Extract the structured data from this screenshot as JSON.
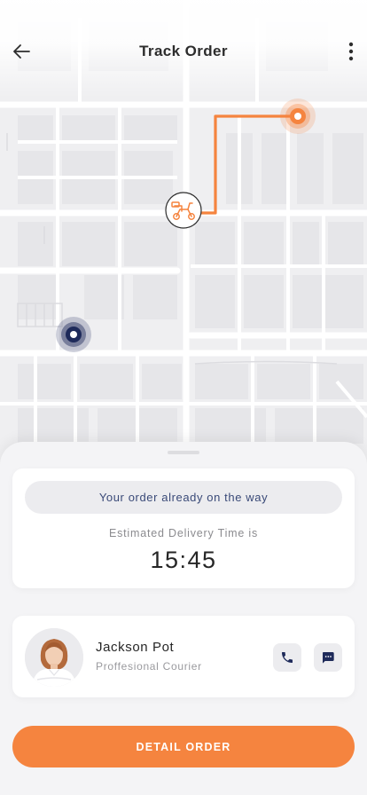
{
  "header": {
    "title": "Track Order",
    "back_icon": "arrow-left-icon",
    "menu_icon": "more-vertical-icon"
  },
  "map": {
    "route_start_color": "#1e2a5a",
    "route_end_color": "#f5843f",
    "courier_icon": "scooter-icon",
    "destination_icon": "location-pin-icon",
    "origin_icon": "origin-dot-icon"
  },
  "status": {
    "message": "Your order already on the way",
    "eta_label": "Estimated Delivery Time is",
    "eta_time": "15:45"
  },
  "courier": {
    "name": "Jackson Pot",
    "role": "Proffesional Courier",
    "call_icon": "phone-icon",
    "chat_icon": "chat-icon"
  },
  "actions": {
    "detail_order_label": "DETAIL ORDER"
  },
  "colors": {
    "accent": "#f5843f",
    "navy": "#1e2a5a"
  }
}
